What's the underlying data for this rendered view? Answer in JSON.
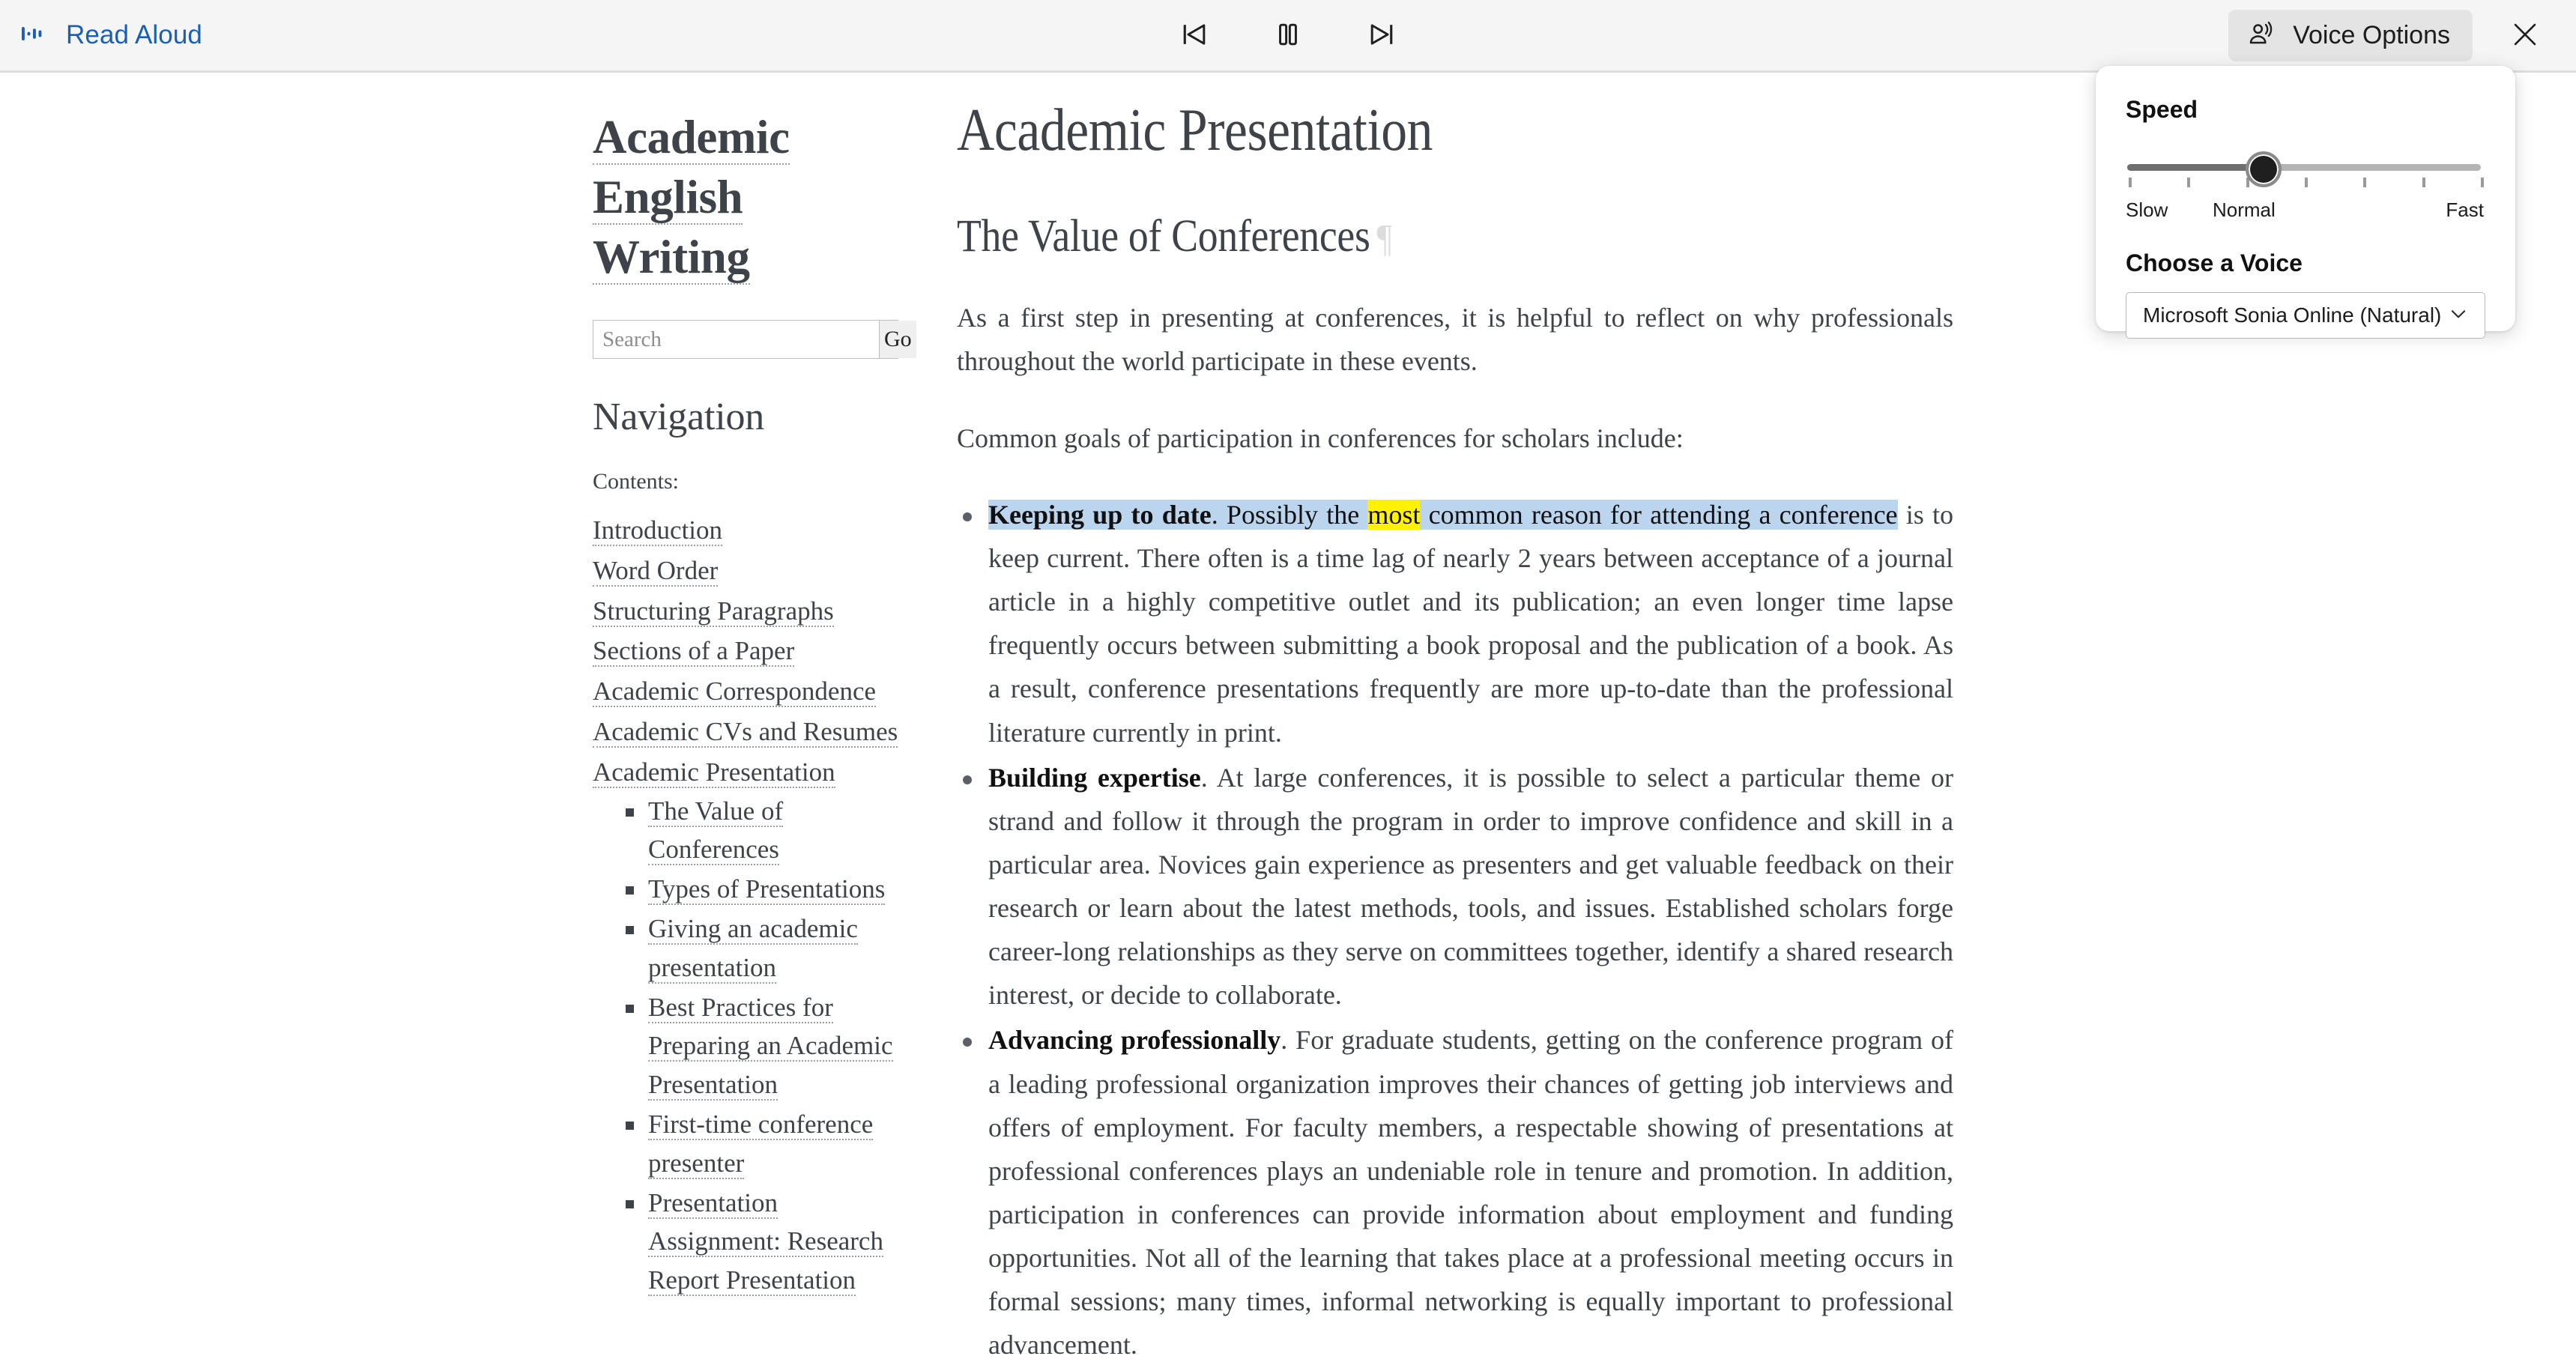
{
  "toolbar": {
    "read_aloud_label": "Read Aloud",
    "wave_icon": "audio-wave-icon",
    "previous_label": "previous-paragraph-icon",
    "pause_label": "pause-icon",
    "next_label": "next-paragraph-icon",
    "voice_options_label": "Voice Options",
    "voice_icon": "voice-speaking-icon",
    "close_label": "close-icon",
    "accent_color": "#1a5fb4",
    "background_color": "#f5f5f5"
  },
  "voice_panel": {
    "speed_heading": "Speed",
    "speed_value_label": "Normal",
    "speed_tick_count": 7,
    "speed_selected_tick": 2,
    "scale": {
      "min": "Slow",
      "mid": "Normal",
      "max": "Fast"
    },
    "voice_heading": "Choose a Voice",
    "selected_voice": "Microsoft Sonia Online (Natural) -",
    "chevron_icon": "chevron-down-icon"
  },
  "sidebar": {
    "site_title_lines": [
      "Academic",
      "English",
      "Writing"
    ],
    "search": {
      "placeholder": "Search",
      "value": "",
      "go_label": "Go"
    },
    "nav_heading": "Navigation",
    "contents_label": "Contents:",
    "toc": [
      {
        "label": "Introduction"
      },
      {
        "label": "Word Order"
      },
      {
        "label": "Structuring Paragraphs"
      },
      {
        "label": "Sections of a Paper"
      },
      {
        "label": "Academic Correspondence"
      },
      {
        "label": "Academic CVs and Resumes"
      },
      {
        "label": "Academic Presentation",
        "children": [
          {
            "label": "The Value of Conferences"
          },
          {
            "label": "Types of Presentations"
          },
          {
            "label": "Giving an academic presentation"
          },
          {
            "label": "Best Practices for Preparing an Academic Presentation"
          },
          {
            "label": "First-time conference presenter"
          },
          {
            "label": "Presentation Assignment: Research Report Presentation"
          }
        ]
      }
    ]
  },
  "content": {
    "page_title": "Academic Presentation",
    "section_heading": "The Value of Conferences",
    "anchor_symbol": "¶",
    "paragraphs": [
      "As a first step in presenting at conferences, it is helpful to reflect on why professionals throughout the world participate in these events.",
      "Common goals of participation in conferences for scholars include:"
    ],
    "goals": [
      {
        "term": "Keeping up to date",
        "highlighted_lead": ". Possibly the ",
        "highlighted_word": "most",
        "highlighted_tail": " common reason for attending a conference",
        "rest": " is to keep current. There often is a time lag of nearly 2 years between acceptance of a journal article in a highly competitive outlet and its publication; an even longer time lapse frequently occurs between submitting a book proposal and the publication of a book. As a result, conference presentations frequently are more up-to-date than the professional literature currently in print."
      },
      {
        "term": "Building expertise",
        "rest": ". At large conferences, it is possible to select a particular theme or strand and follow it through the program in order to improve confidence and skill in a particular area. Novices gain experience as presenters and get valuable feedback on their research or learn about the latest methods, tools, and issues. Established scholars forge career-long relationships as they serve on committees together, identify a shared research interest, or decide to collaborate."
      },
      {
        "term": "Advancing professionally",
        "rest": ". For graduate students, getting on the conference program of a leading professional organization improves their chances of getting job interviews and offers of employment. For faculty members, a respectable showing of presentations at professional conferences plays an undeniable role in tenure and promotion. In addition, participation in conferences can provide information about employment and funding opportunities. Not all of the learning that takes place at a professional meeting occurs in formal sessions; many times, informal networking is equally important to professional advancement."
      }
    ],
    "highlight_selection_color": "#bcd5ef",
    "highlight_word_color": "#fff200"
  }
}
